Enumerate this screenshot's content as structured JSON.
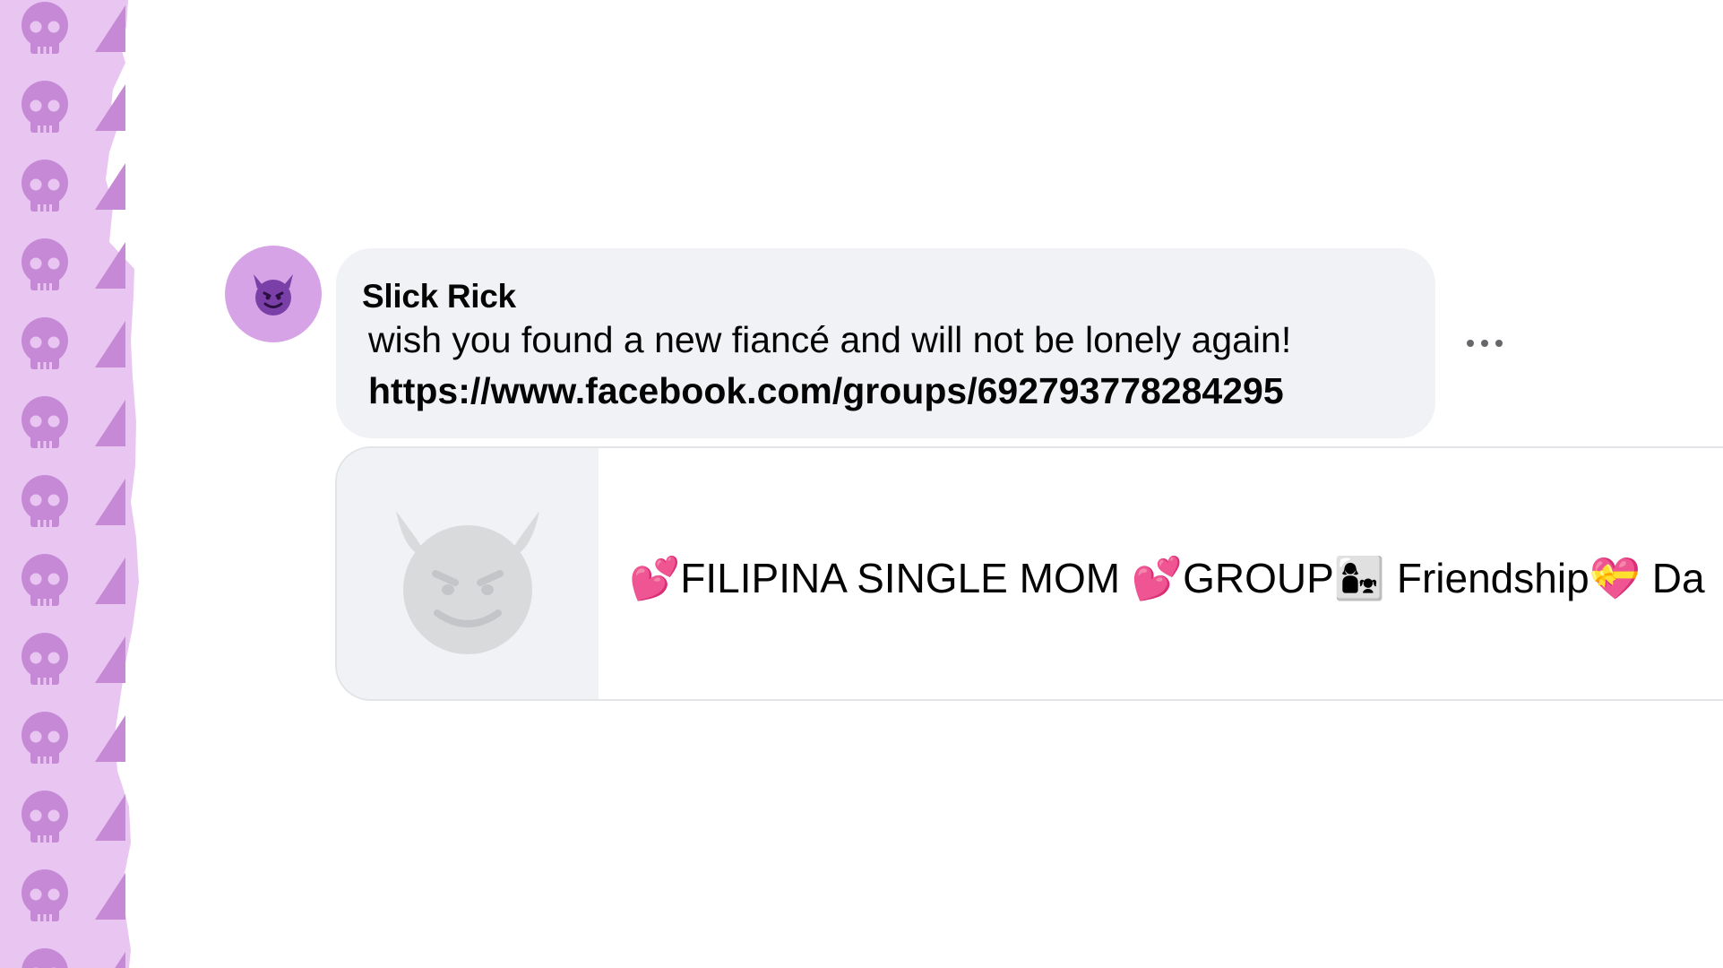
{
  "comment": {
    "author": "Slick Rick",
    "text": "wish you found a new fiancé and will not be lonely again!",
    "link": "https://www.facebook.com/groups/692793778284295",
    "avatar_icon": "devil-emoji-icon"
  },
  "link_preview": {
    "title_parts": [
      "FILIPINA SINGLE MOM ",
      "GROUP",
      " Friendship",
      " Da"
    ],
    "thumbnail_icon": "devil-emoji-icon",
    "emoji_icons": [
      "two-hearts-icon",
      "two-hearts-icon",
      "family-icon",
      "heart-ribbon-icon"
    ]
  },
  "actions": {
    "more_icon": "more-options-icon"
  },
  "colors": {
    "bubble_bg": "#f0f2f5",
    "strip_bg": "#e9c6f1",
    "strip_icon": "#c589d6",
    "avatar_bg": "#d6a3e6"
  }
}
